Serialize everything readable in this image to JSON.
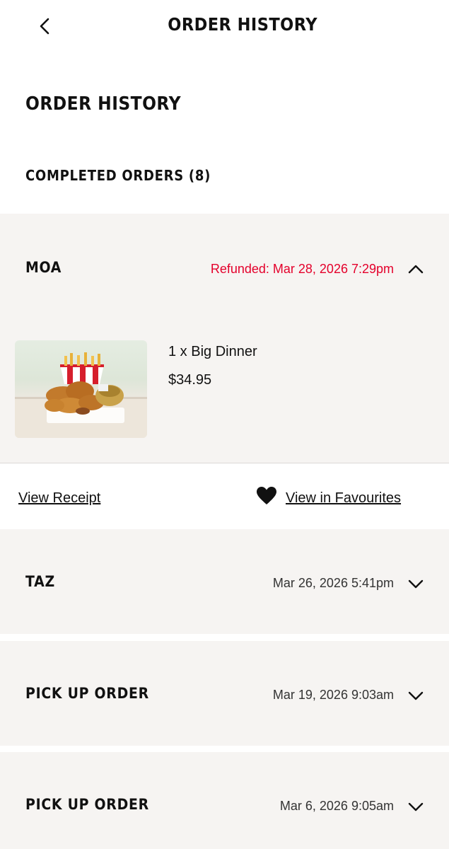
{
  "header": {
    "title": "ORDER HISTORY",
    "back_icon": "chevron-left-icon"
  },
  "page": {
    "title": "ORDER HISTORY",
    "section_label": "COMPLETED ORDERS (8)"
  },
  "colors": {
    "refund": "#e4002b",
    "card_bg": "#f6f4f2"
  },
  "orders": [
    {
      "name": "MOA",
      "status": "Refunded: Mar 28, 2026 7:29pm",
      "expanded": true,
      "items": [
        {
          "description": "1 x Big Dinner",
          "price": "$34.95"
        }
      ],
      "actions": {
        "receipt": "View Receipt",
        "favourites": "View in Favourites"
      }
    },
    {
      "name": "TAZ",
      "status": "Mar 26, 2026 5:41pm",
      "expanded": false
    },
    {
      "name": "PICK UP ORDER",
      "status": "Mar 19, 2026 9:03am",
      "expanded": false
    },
    {
      "name": "PICK UP ORDER",
      "status": "Mar 6, 2026 9:05am",
      "expanded": false
    }
  ]
}
